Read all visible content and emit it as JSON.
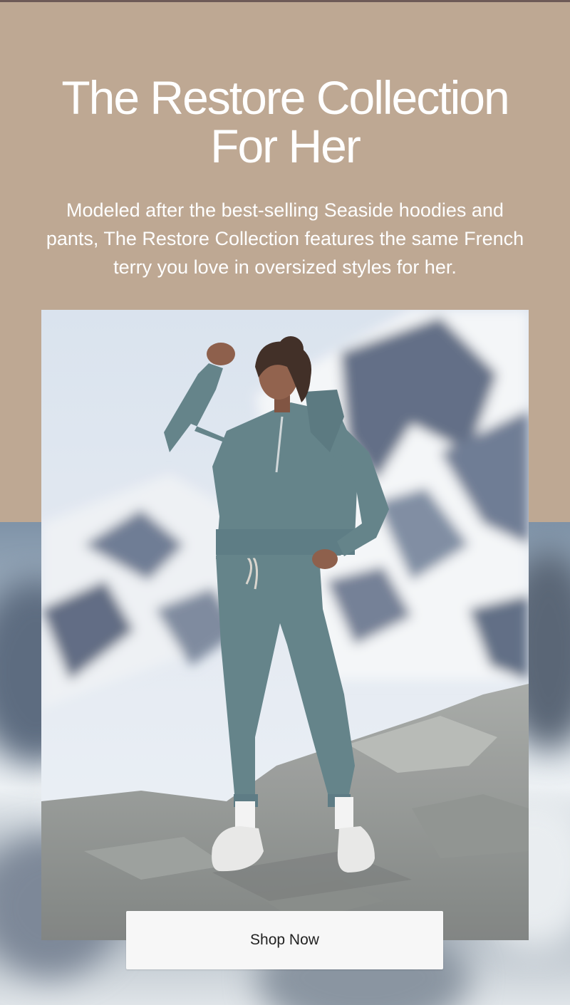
{
  "hero": {
    "title_line1": "The Restore Collection",
    "title_line2": "For Her",
    "description": "Modeled after the best-selling Seaside hoodies and pants, The Restore Collection features the same French terry you love in oversized styles for her."
  },
  "cta": {
    "label": "Shop Now"
  },
  "colors": {
    "hero_background": "#bea893",
    "top_rule": "#6e5a57",
    "button_background": "#f7f7f7",
    "button_text": "#222222",
    "outfit": "#5f7f86"
  }
}
